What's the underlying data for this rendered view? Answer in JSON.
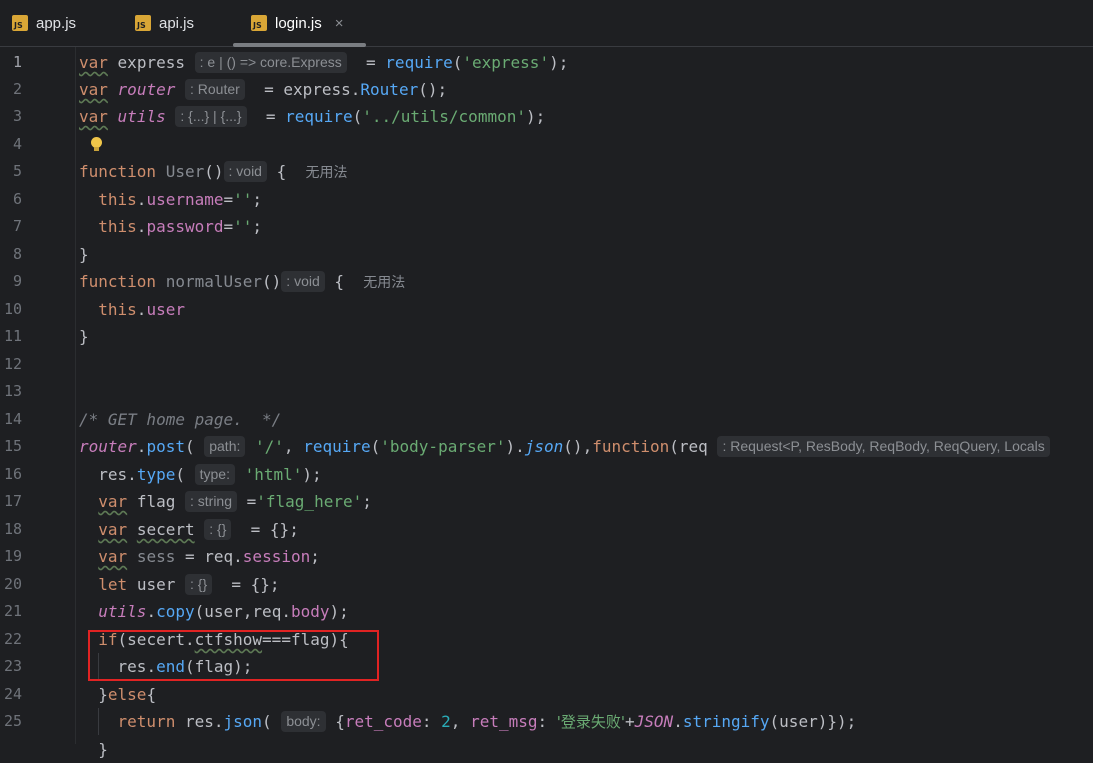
{
  "tabs": [
    {
      "label": "app.js",
      "icon": "js-file-icon",
      "icon_text": "JS",
      "active": false
    },
    {
      "label": "api.js",
      "icon": "js-file-icon",
      "icon_text": "JS",
      "active": false
    },
    {
      "label": "login.js",
      "icon": "js-file-icon",
      "icon_text": "JS",
      "active": true,
      "close": "×"
    }
  ],
  "colors": {
    "background": "#1e1f22",
    "keyword": "#cf8e6d",
    "function": "#56a8f5",
    "string": "#6aab73",
    "highlight_box": "#e12323"
  },
  "editor": {
    "current_line": "1",
    "lines": [
      {
        "n": "1"
      },
      {
        "n": "2"
      },
      {
        "n": "3"
      },
      {
        "n": "4"
      },
      {
        "n": "5"
      },
      {
        "n": "6"
      },
      {
        "n": "7"
      },
      {
        "n": "8"
      },
      {
        "n": "9"
      },
      {
        "n": "10"
      },
      {
        "n": "11"
      },
      {
        "n": "12"
      },
      {
        "n": "13"
      },
      {
        "n": "14"
      },
      {
        "n": "15"
      },
      {
        "n": "16"
      },
      {
        "n": "17"
      },
      {
        "n": "18"
      },
      {
        "n": "19"
      },
      {
        "n": "20"
      },
      {
        "n": "21"
      },
      {
        "n": "22"
      },
      {
        "n": "23"
      },
      {
        "n": "24"
      },
      {
        "n": "25"
      }
    ],
    "tokens": {
      "var": "var",
      "function": "function",
      "let": "let",
      "this": "this",
      "if": "if",
      "return": "return",
      "express": "express",
      "router": "router",
      "utils": "utils",
      "require": "require",
      "Router": "Router",
      "express_str": "'express'",
      "utils_path": "'../utils/common'",
      "User": "User",
      "normalUser": "normalUser",
      "username": "username",
      "password": "password",
      "user": "user",
      "empty_str": "''",
      "comment": "/* GET home page.  */",
      "post": "post",
      "slash": "'/'",
      "body_parser": "'body-parser'",
      "json": "json",
      "req": "req",
      "res": "res",
      "type": "type",
      "html_str": "'html'",
      "flag": "flag",
      "flag_here": "'flag_here'",
      "secert": "secert",
      "sess": "sess",
      "session": "session",
      "copy": "copy",
      "body": "body",
      "ctfshow": "ctfshow",
      "end": "end",
      "ret_code": "ret_code",
      "two": "2",
      "ret_msg": "ret_msg",
      "login_fail": "'登录失败'",
      "JSON": "JSON",
      "stringify": "stringify"
    },
    "hints": {
      "express_type": ": e | () => core.Express",
      "router_type": ": Router",
      "utils_type": ": {...} | {...}",
      "user_type": ": void",
      "normal_user_type": ": void",
      "unused": "无用法",
      "path_hint": "path:",
      "req_type": ": Request<P, ResBody, ReqBody, ReqQuery, Locals",
      "type_hint": "type:",
      "flag_type": ": string",
      "secert_type": ": {}",
      "user_obj_type": ": {}",
      "body_hint": "body:"
    }
  }
}
